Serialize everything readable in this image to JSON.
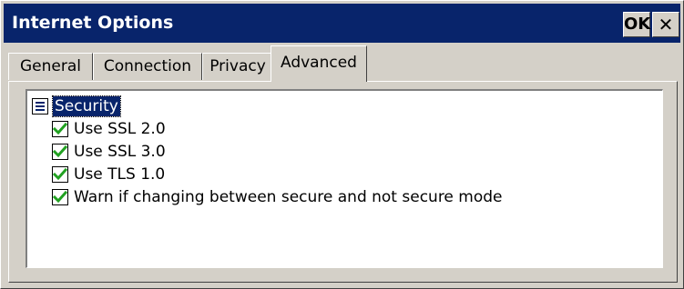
{
  "window": {
    "title": "Internet Options",
    "ok_label": "OK",
    "close_label": "✕"
  },
  "tabs": [
    {
      "label": "General",
      "active": false
    },
    {
      "label": "Connection",
      "active": false
    },
    {
      "label": "Privacy",
      "active": false
    },
    {
      "label": "Advanced",
      "active": true
    }
  ],
  "tree": {
    "root": {
      "label": "Security",
      "icon": "settings-group-icon",
      "selected": true
    },
    "items": [
      {
        "label": "Use SSL 2.0",
        "checked": true
      },
      {
        "label": "Use SSL 3.0",
        "checked": true
      },
      {
        "label": "Use TLS 1.0",
        "checked": true
      },
      {
        "label": "Warn if changing between secure and not secure mode",
        "checked": true
      }
    ]
  },
  "colors": {
    "titlebar": "#08246b",
    "checkmark": "#21a121",
    "face": "#d4d0c8"
  }
}
